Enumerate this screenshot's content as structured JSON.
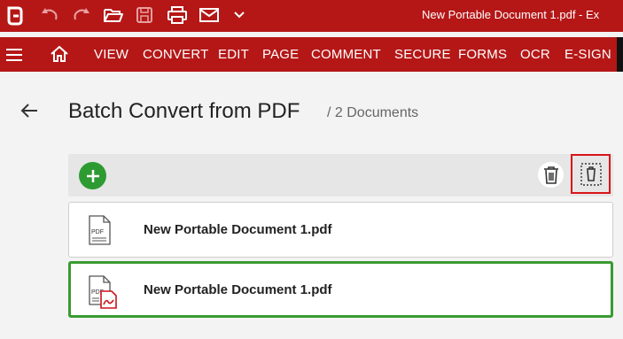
{
  "window": {
    "title": "New Portable Document 1.pdf  -  Ex"
  },
  "toolbar_icons": [
    "app-logo-icon",
    "undo-icon",
    "redo-icon",
    "open-folder-icon",
    "save-icon",
    "print-icon",
    "email-icon",
    "chevron-down-icon"
  ],
  "menu": {
    "items": [
      "VIEW",
      "CONVERT",
      "EDIT",
      "PAGE",
      "COMMENT",
      "SECURE",
      "FORMS",
      "OCR",
      "E-SIGN"
    ]
  },
  "page": {
    "title": "Batch Convert from PDF",
    "count": "/ 2 Documents"
  },
  "documents": [
    {
      "name": "New Portable Document 1.pdf",
      "icon_label": "PDF",
      "selected": false
    },
    {
      "name": "New Portable Document 1.pdf",
      "icon_label": "PDF",
      "selected": true
    }
  ],
  "colors": {
    "brand": "#b51717",
    "add_button": "#2e9b32",
    "selected_border": "#3a9b31",
    "highlight_box": "#d8141a"
  }
}
